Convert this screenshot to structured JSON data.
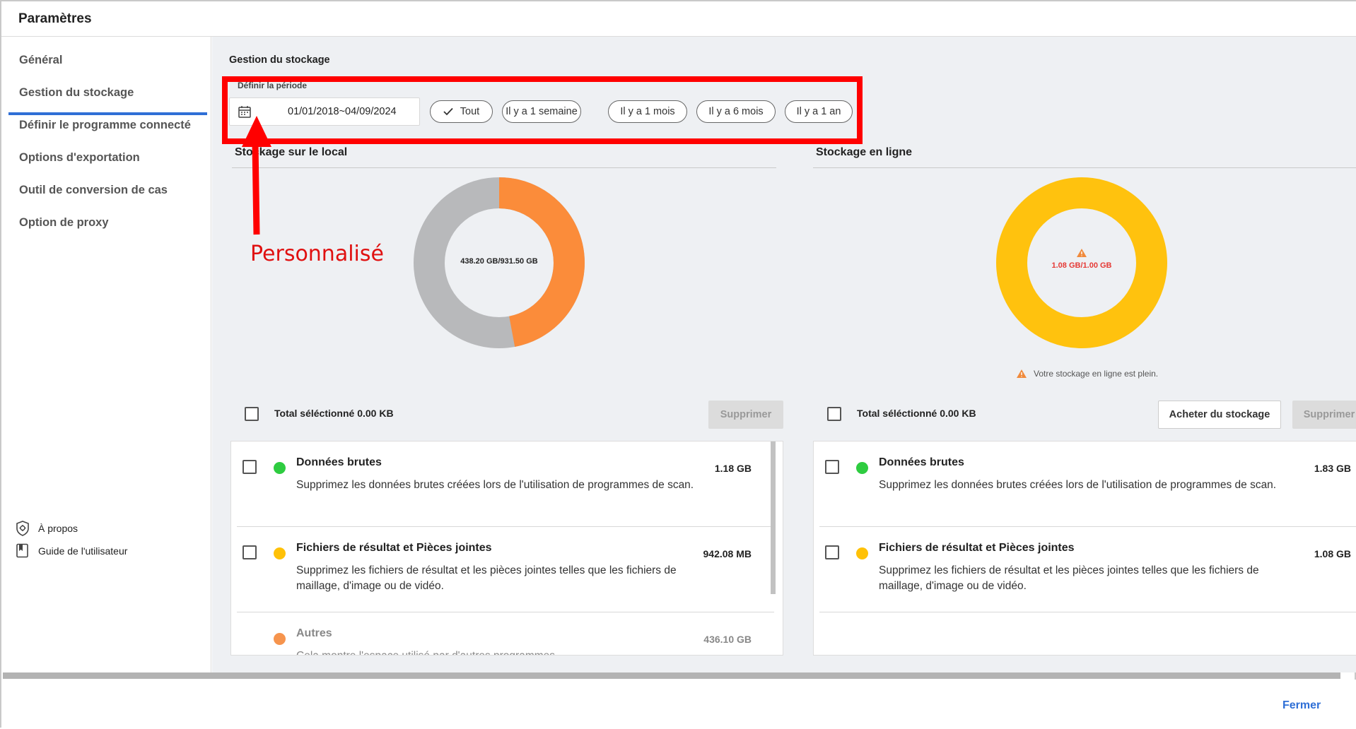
{
  "window": {
    "title": "Paramètres"
  },
  "sidebar": {
    "items": [
      {
        "label": "Général"
      },
      {
        "label": "Gestion du stockage"
      },
      {
        "label": "Définir le programme connecté"
      },
      {
        "label": "Options d'exportation"
      },
      {
        "label": "Outil de conversion de cas"
      },
      {
        "label": "Option de proxy"
      }
    ],
    "footer": [
      {
        "label": "À propos",
        "icon": "shield-icon"
      },
      {
        "label": "Guide de l'utilisateur",
        "icon": "book-icon"
      }
    ]
  },
  "main": {
    "title": "Gestion du stockage",
    "period": {
      "label": "Définir la période",
      "date_range": "01/01/2018~04/09/2024",
      "chips": [
        "Tout",
        "Il y a 1 semaine",
        "Il y a 1 mois",
        "Il y a 6 mois",
        "Il y a 1 an"
      ],
      "selected_chip": "Tout"
    },
    "annotation": {
      "label": "Personnalisé",
      "color": "#ff0000"
    },
    "local": {
      "section_title": "Stockage sur le local",
      "usage_text": "438.20 GB/931.50 GB",
      "used_fraction": 0.4704,
      "used_color": "#fb8c3a",
      "free_color": "#b8b9bb",
      "total_label": "Total séléctionné 0.00 KB",
      "delete_label": "Supprimer",
      "rows": [
        {
          "title": "Données brutes",
          "description": "Supprimez les données brutes créées lors de l'utilisation de programmes de scan.",
          "size": "1.18 GB",
          "color": "#2ecc40"
        },
        {
          "title": "Fichiers de résultat et Pièces jointes",
          "description": "Supprimez les fichiers de résultat et les pièces jointes telles que les fichiers de maillage, d'image ou de vidéo.",
          "size": "942.08 MB",
          "color": "#ffc107"
        },
        {
          "title": "Autres",
          "description": "Cela montre l'espace utilisé par d'autres programmes.",
          "size": "436.10 GB",
          "color": "#f5883a"
        }
      ]
    },
    "online": {
      "section_title": "Stockage en ligne",
      "usage_text": "1.08 GB/1.00 GB",
      "ring_color": "#ffc20e",
      "warning_color": "#f08a3c",
      "usage_text_color": "#e53935",
      "warning_text": "Votre stockage en ligne est plein.",
      "total_label": "Total séléctionné 0.00 KB",
      "buy_label": "Acheter du stockage",
      "delete_label": "Supprimer",
      "rows": [
        {
          "title": "Données brutes",
          "description": "Supprimez les données brutes créées lors de l'utilisation de programmes de scan.",
          "size": "1.83 GB",
          "color": "#2ecc40"
        },
        {
          "title": "Fichiers de résultat et Pièces jointes",
          "description": "Supprimez les fichiers de résultat et les pièces jointes telles que les fichiers de maillage, d'image ou de vidéo.",
          "size": "1.08 GB",
          "color": "#ffc107"
        }
      ]
    }
  },
  "footer": {
    "close_label": "Fermer",
    "accent": "#2f6fd6"
  }
}
